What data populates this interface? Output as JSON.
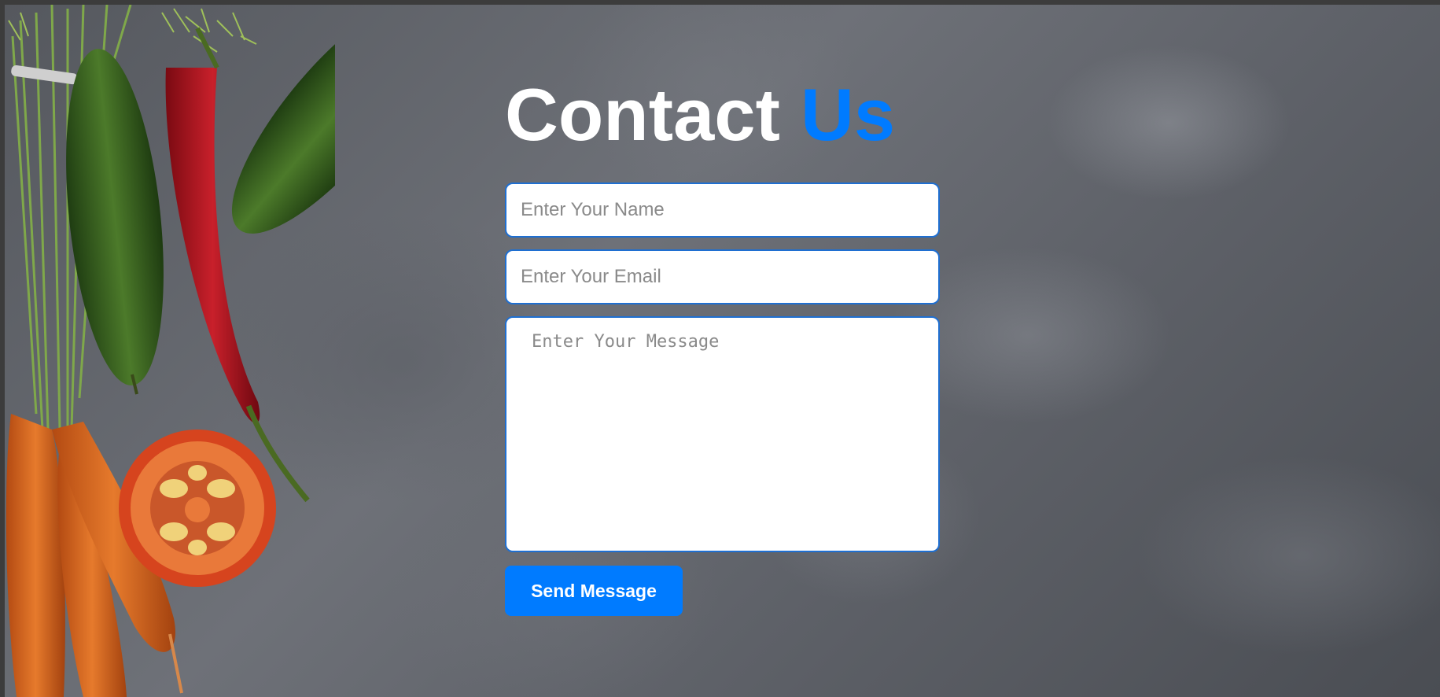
{
  "heading": {
    "part1": "Contact",
    "part2": "Us"
  },
  "form": {
    "name_placeholder": "Enter Your Name",
    "email_placeholder": "Enter Your Email",
    "message_placeholder": "Enter Your Message",
    "submit_label": "Send Message"
  },
  "colors": {
    "accent": "#007bff",
    "heading": "#ffffff",
    "background": "#5e6168"
  }
}
